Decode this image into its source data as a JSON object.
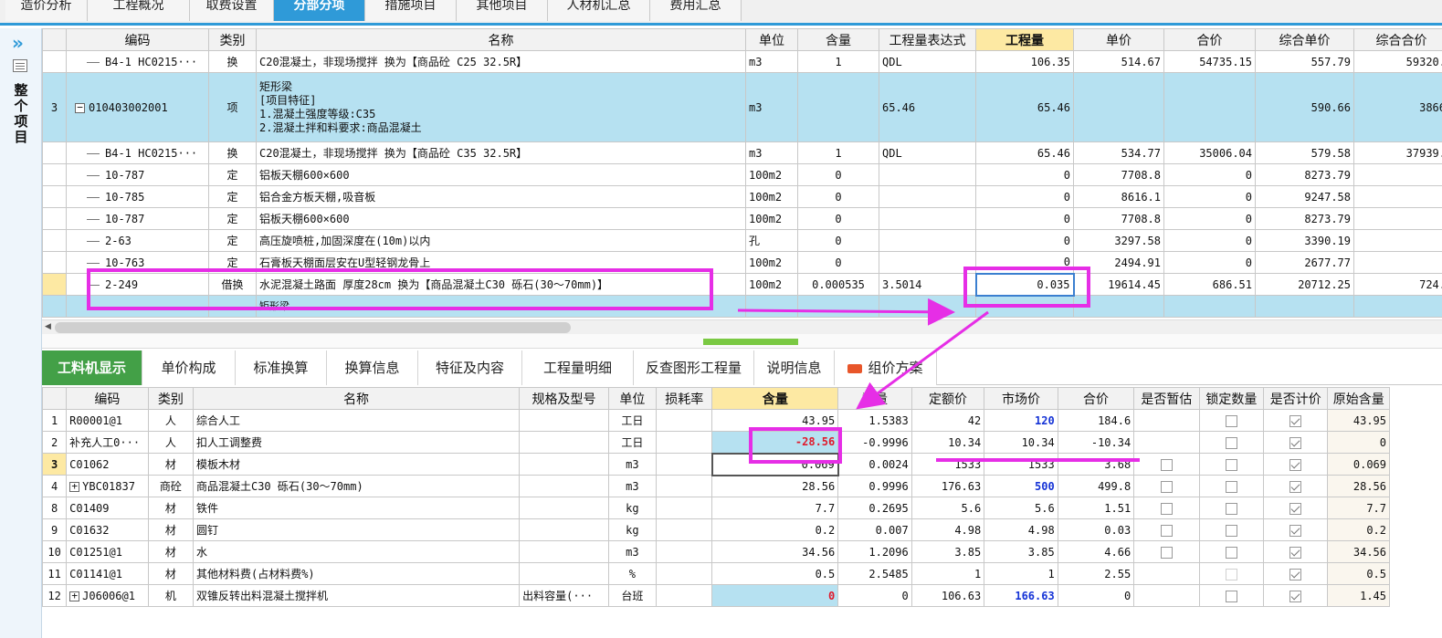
{
  "top_tabs": [
    "造价分析",
    "工程概况",
    "取费设置",
    "分部分项",
    "措施项目",
    "其他项目",
    "人材机汇总",
    "费用汇总"
  ],
  "side": {
    "label": "整个项目"
  },
  "upper": {
    "headers": [
      "编码",
      "类别",
      "名称",
      "单位",
      "含量",
      "工程量表达式",
      "工程量",
      "单价",
      "合价",
      "综合单价",
      "综合合价"
    ],
    "rows": [
      {
        "rn": "",
        "code": "B4-1 HC0215···",
        "type": "换",
        "name": "C20混凝土，非现场搅拌  换为【商品砼 C25 32.5R】",
        "unit": "m3",
        "qty": "1",
        "expr": "QDL",
        "amount": "106.35",
        "price": "514.67",
        "total": "54735.15",
        "cprice": "557.79",
        "ctotal": "59320."
      },
      {
        "rn": "3",
        "code": "010403002001",
        "type": "项",
        "name_lines": [
          "矩形梁",
          "[项目特征]",
          "1.混凝土强度等级:C35",
          "2.混凝土拌和料要求:商品混凝土"
        ],
        "unit": "m3",
        "qty": "",
        "expr": "65.46",
        "amount": "65.46",
        "price": "",
        "total": "",
        "cprice": "590.66",
        "ctotal": "3866"
      },
      {
        "rn": "",
        "code": "B4-1 HC0215···",
        "type": "换",
        "name": "C20混凝土，非现场搅拌  换为【商品砼 C35 32.5R】",
        "unit": "m3",
        "qty": "1",
        "expr": "QDL",
        "amount": "65.46",
        "price": "534.77",
        "total": "35006.04",
        "cprice": "579.58",
        "ctotal": "37939."
      },
      {
        "rn": "",
        "code": "10-787",
        "type": "定",
        "name": "铝板天棚600×600",
        "unit": "100m2",
        "qty": "0",
        "expr": "",
        "amount": "0",
        "price": "7708.8",
        "total": "0",
        "cprice": "8273.79",
        "ctotal": ""
      },
      {
        "rn": "",
        "code": "10-785",
        "type": "定",
        "name": "铝合金方板天棚,吸音板",
        "unit": "100m2",
        "qty": "0",
        "expr": "",
        "amount": "0",
        "price": "8616.1",
        "total": "0",
        "cprice": "9247.58",
        "ctotal": ""
      },
      {
        "rn": "",
        "code": "10-787",
        "type": "定",
        "name": "铝板天棚600×600",
        "unit": "100m2",
        "qty": "0",
        "expr": "",
        "amount": "0",
        "price": "7708.8",
        "total": "0",
        "cprice": "8273.79",
        "ctotal": ""
      },
      {
        "rn": "",
        "code": "2-63",
        "type": "定",
        "name": "高压旋喷桩,加固深度在(10m)以内",
        "unit": "孔",
        "qty": "0",
        "expr": "",
        "amount": "0",
        "price": "3297.58",
        "total": "0",
        "cprice": "3390.19",
        "ctotal": ""
      },
      {
        "rn": "",
        "code": "10-763",
        "type": "定",
        "name": "石膏板天棚面层安在U型轻钢龙骨上",
        "unit": "100m2",
        "qty": "0",
        "expr": "",
        "amount": "0",
        "price": "2494.91",
        "total": "0",
        "cprice": "2677.77",
        "ctotal": ""
      },
      {
        "rn": "",
        "code": "2-249",
        "type": "借换",
        "name": "水泥混凝土路面 厚度28cm  换为【商品混凝土C30 砾石(30～70mm)】",
        "unit": "100m2",
        "qty": "0.000535",
        "expr": "3.5014",
        "amount": "0.035",
        "price": "19614.45",
        "total": "686.51",
        "cprice": "20712.25",
        "ctotal": "724."
      },
      {
        "rn": "",
        "code": "",
        "type": "",
        "name": "矩形梁",
        "unit": "",
        "qty": "",
        "expr": "",
        "amount": "",
        "price": "",
        "total": "",
        "cprice": "",
        "ctotal": ""
      }
    ]
  },
  "bottom_tabs": [
    "工料机显示",
    "单价构成",
    "标准换算",
    "换算信息",
    "特征及内容",
    "工程量明细",
    "反查图形工程量",
    "说明信息",
    "组价方案"
  ],
  "lower": {
    "headers": [
      "编码",
      "类别",
      "名称",
      "规格及型号",
      "单位",
      "损耗率",
      "含量",
      "数量",
      "定额价",
      "市场价",
      "合价",
      "是否暂估",
      "锁定数量",
      "是否计价",
      "原始含量"
    ],
    "rows": [
      {
        "rn": "1",
        "code": "R00001@1",
        "type": "人",
        "name": "综合人工",
        "spec": "",
        "unit": "工日",
        "loss": "",
        "qty": "43.95",
        "num": "1.5383",
        "dprice": "42",
        "mprice": "120",
        "total": "184.6",
        "zg": false,
        "lock": false,
        "jj": true,
        "orig": "43.95"
      },
      {
        "rn": "2",
        "code": "补充人工0···",
        "type": "人",
        "name": "扣人工调整费",
        "spec": "",
        "unit": "工日",
        "loss": "",
        "qty": "-28.56",
        "num": "-0.9996",
        "dprice": "10.34",
        "mprice": "10.34",
        "total": "-10.34",
        "zg": false,
        "lock": false,
        "jj": true,
        "orig": "0"
      },
      {
        "rn": "3",
        "code": "C01062",
        "type": "材",
        "name": "模板木材",
        "spec": "",
        "unit": "m3",
        "loss": "",
        "qty": "0.069",
        "num": "0.0024",
        "dprice": "1533",
        "mprice": "1533",
        "total": "3.68",
        "zg": false,
        "lock": false,
        "jj": true,
        "orig": "0.069"
      },
      {
        "rn": "4",
        "code": "YBC01837",
        "type": "商砼",
        "name": "商品混凝土C30 砾石(30～70mm)",
        "spec": "",
        "unit": "m3",
        "loss": "",
        "qty": "28.56",
        "num": "0.9996",
        "dprice": "176.63",
        "mprice": "500",
        "total": "499.8",
        "zg": false,
        "lock": false,
        "jj": true,
        "orig": "28.56"
      },
      {
        "rn": "8",
        "code": "C01409",
        "type": "材",
        "name": "铁件",
        "spec": "",
        "unit": "kg",
        "loss": "",
        "qty": "7.7",
        "num": "0.2695",
        "dprice": "5.6",
        "mprice": "5.6",
        "total": "1.51",
        "zg": false,
        "lock": false,
        "jj": true,
        "orig": "7.7"
      },
      {
        "rn": "9",
        "code": "C01632",
        "type": "材",
        "name": "圆钉",
        "spec": "",
        "unit": "kg",
        "loss": "",
        "qty": "0.2",
        "num": "0.007",
        "dprice": "4.98",
        "mprice": "4.98",
        "total": "0.03",
        "zg": false,
        "lock": false,
        "jj": true,
        "orig": "0.2"
      },
      {
        "rn": "10",
        "code": "C01251@1",
        "type": "材",
        "name": "水",
        "spec": "",
        "unit": "m3",
        "loss": "",
        "qty": "34.56",
        "num": "1.2096",
        "dprice": "3.85",
        "mprice": "3.85",
        "total": "4.66",
        "zg": false,
        "lock": false,
        "jj": true,
        "orig": "34.56"
      },
      {
        "rn": "11",
        "code": "C01141@1",
        "type": "材",
        "name": "其他材料费(占材料费%)",
        "spec": "",
        "unit": "%",
        "loss": "",
        "qty": "0.5",
        "num": "2.5485",
        "dprice": "1",
        "mprice": "1",
        "total": "2.55",
        "zg": false,
        "lock": false,
        "jj": true,
        "orig": "0.5"
      },
      {
        "rn": "12",
        "code": "J06006@1",
        "type": "机",
        "name": "双锥反转出料混凝土搅拌机",
        "spec": "出料容量(···",
        "unit": "台班",
        "loss": "",
        "qty": "0",
        "num": "0",
        "dprice": "106.63",
        "mprice": "166.63",
        "total": "0",
        "zg": false,
        "lock": false,
        "jj": true,
        "orig": "1.45"
      }
    ]
  },
  "colors": {
    "accent": "#2f9ad8",
    "annotation": "#e62ee6",
    "selected_row": "#b6e1f1",
    "header_highlight": "#fde9a3",
    "active_bottom_tab": "#43a047"
  }
}
